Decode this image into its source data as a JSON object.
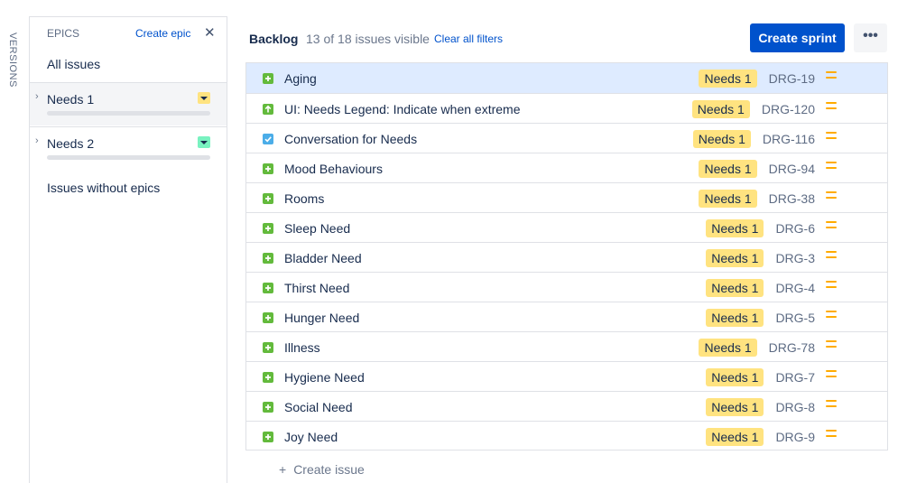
{
  "versions": {
    "label": "VERSIONS"
  },
  "epics": {
    "title": "EPICS",
    "create_label": "Create epic",
    "close_glyph": "✕",
    "all_issues": "All issues",
    "items": [
      {
        "name": "Needs 1",
        "color": "#ffe380",
        "progress": 0
      },
      {
        "name": "Needs 2",
        "color": "#79f2c0",
        "progress": 0
      }
    ],
    "issues_without": "Issues without epics"
  },
  "backlog": {
    "title": "Backlog",
    "visible_count": "13 of 18 issues visible",
    "clear_filters": "Clear all filters",
    "create_sprint": "Create sprint",
    "more_glyph": "•••"
  },
  "issues": [
    {
      "type": "story",
      "summary": "Aging",
      "epic": "Needs 1",
      "key": "DRG-19",
      "priority": "medium"
    },
    {
      "type": "improvement",
      "summary": "UI: Needs Legend: Indicate when extreme",
      "epic": "Needs 1",
      "key": "DRG-120",
      "priority": "medium"
    },
    {
      "type": "task",
      "summary": "Conversation for Needs",
      "epic": "Needs 1",
      "key": "DRG-116",
      "priority": "medium"
    },
    {
      "type": "story",
      "summary": "Mood Behaviours",
      "epic": "Needs 1",
      "key": "DRG-94",
      "priority": "medium"
    },
    {
      "type": "story",
      "summary": "Rooms",
      "epic": "Needs 1",
      "key": "DRG-38",
      "priority": "medium"
    },
    {
      "type": "story",
      "summary": "Sleep Need",
      "epic": "Needs 1",
      "key": "DRG-6",
      "priority": "medium"
    },
    {
      "type": "story",
      "summary": "Bladder Need",
      "epic": "Needs 1",
      "key": "DRG-3",
      "priority": "medium"
    },
    {
      "type": "story",
      "summary": "Thirst Need",
      "epic": "Needs 1",
      "key": "DRG-4",
      "priority": "medium"
    },
    {
      "type": "story",
      "summary": "Hunger Need",
      "epic": "Needs 1",
      "key": "DRG-5",
      "priority": "medium"
    },
    {
      "type": "story",
      "summary": "Illness",
      "epic": "Needs 1",
      "key": "DRG-78",
      "priority": "medium"
    },
    {
      "type": "story",
      "summary": "Hygiene Need",
      "epic": "Needs 1",
      "key": "DRG-7",
      "priority": "medium"
    },
    {
      "type": "story",
      "summary": "Social Need",
      "epic": "Needs 1",
      "key": "DRG-8",
      "priority": "medium"
    },
    {
      "type": "story",
      "summary": "Joy Need",
      "epic": "Needs 1",
      "key": "DRG-9",
      "priority": "medium"
    }
  ],
  "create_issue": {
    "plus": "+",
    "label": "Create issue"
  },
  "colors": {
    "accent": "#0052cc",
    "story": "#63ba3c",
    "task": "#4bade8",
    "priority_medium": "#ffab00",
    "selected_row": "#deebff",
    "epic_lozenge": "#ffe380"
  }
}
